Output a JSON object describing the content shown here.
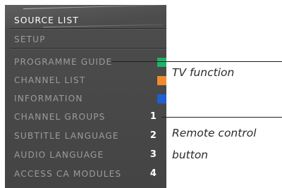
{
  "menu": {
    "items": [
      {
        "label": "SOURCE LIST",
        "indicator": null,
        "key": null
      },
      {
        "label": "SETUP",
        "indicator": null,
        "key": null
      },
      {
        "label": "PROGRAMME GUIDE",
        "indicator": "green",
        "key": null
      },
      {
        "label": "CHANNEL LIST",
        "indicator": "orange",
        "key": null
      },
      {
        "label": "INFORMATION",
        "indicator": "blue",
        "key": null
      },
      {
        "label": "CHANNEL GROUPS",
        "indicator": null,
        "key": "1"
      },
      {
        "label": "SUBTITLE LANGUAGE",
        "indicator": null,
        "key": "2"
      },
      {
        "label": "AUDIO LANGUAGE",
        "indicator": null,
        "key": "3"
      },
      {
        "label": "ACCESS CA MODULES",
        "indicator": null,
        "key": "4"
      }
    ]
  },
  "callouts": {
    "tv_function": "TV function",
    "remote_control_line1": "Remote control",
    "remote_control_line2": "button"
  },
  "colors": {
    "panel": "#4a4a4a",
    "text_dim": "#9b9b9b",
    "text_bright": "#ffffff",
    "green": "#1fb36a",
    "orange": "#f28a2e",
    "blue": "#1f5fd1"
  }
}
